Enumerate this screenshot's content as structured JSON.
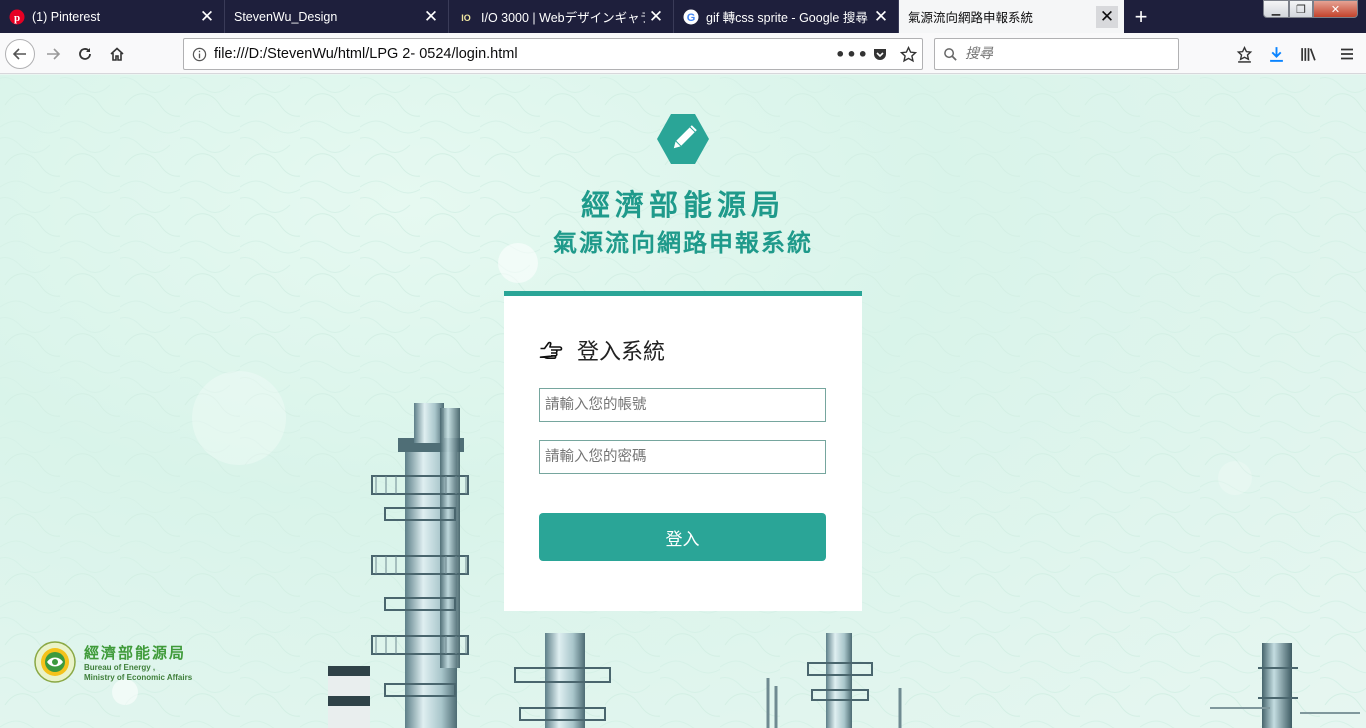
{
  "browser": {
    "tabs": [
      {
        "title": "(1) Pinterest",
        "icon": "pinterest-icon"
      },
      {
        "title": "StevenWu_Design",
        "icon": "none"
      },
      {
        "title": "I/O 3000 | Webデザインギャラ",
        "icon": "io3000-icon"
      },
      {
        "title": "gif 轉css sprite - Google 搜尋",
        "icon": "google-icon"
      },
      {
        "title": "氣源流向網路申報系統",
        "icon": "none"
      }
    ],
    "active_tab": 4,
    "url": "file:///D:/StevenWu/html/LPG 2- 0524/login.html",
    "search_placeholder": "搜尋"
  },
  "page": {
    "agency_title": "經濟部能源局",
    "system_title": "氣源流向網路申報系統",
    "login": {
      "heading": "登入系統",
      "account_placeholder": "請輸入您的帳號",
      "password_placeholder": "請輸入您的密碼",
      "submit_label": "登入"
    },
    "footer_logo": {
      "name_zh": "經濟部能源局",
      "name_en_line1": "Bureau of Energy ,",
      "name_en_line2": "Ministry of Economic Affairs"
    }
  },
  "colors": {
    "accent": "#2aa597",
    "title": "#1f9a8b",
    "tabbar": "#1e1f3c",
    "page_bg": "#e9f6f1"
  }
}
